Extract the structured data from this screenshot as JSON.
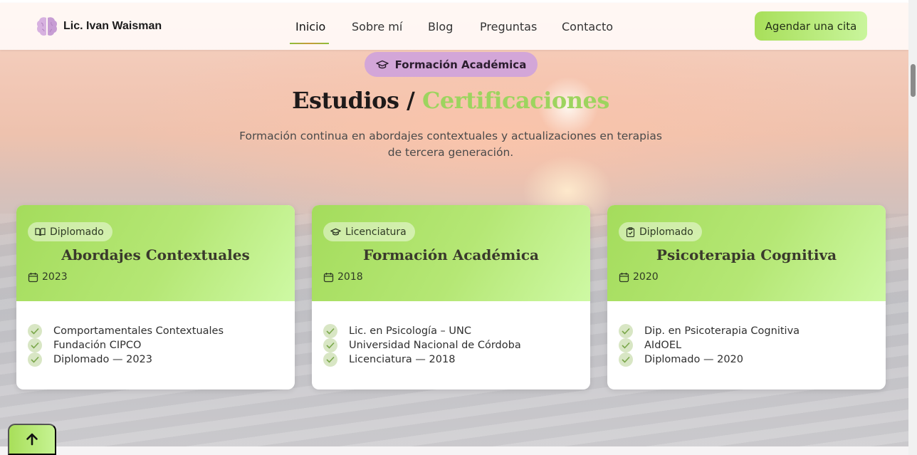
{
  "header": {
    "brand": "Lic. Ivan Waisman",
    "nav": [
      {
        "label": "Inicio",
        "active": true
      },
      {
        "label": "Sobre mí",
        "active": false
      },
      {
        "label": "Blog",
        "active": false
      },
      {
        "label": "Preguntas",
        "active": false
      },
      {
        "label": "Contacto",
        "active": false
      }
    ],
    "cta_label": "Agendar una cita",
    "logo_icon": "brain-icon"
  },
  "section": {
    "badge_label": "Formación Académica",
    "badge_icon": "graduation-cap-icon",
    "title_main": "Estudios",
    "title_sep": " / ",
    "title_accent": "Certificaciones",
    "subtitle": "Formación continua en abordajes contextuales y actualizaciones en terapias de tercera generación."
  },
  "cards": [
    {
      "tag": "Diplomado",
      "tag_icon": "book-open-icon",
      "title": "Abordajes Contextuales",
      "year": "2023",
      "items": [
        "Comportamentales Contextuales",
        "Fundación CIPCO",
        "Diplomado — 2023"
      ]
    },
    {
      "tag": "Licenciatura",
      "tag_icon": "graduation-cap-icon",
      "title": "Formación Académica",
      "year": "2018",
      "items": [
        "Lic. en Psicología – UNC",
        "Universidad Nacional de Córdoba",
        "Licenciatura — 2018"
      ]
    },
    {
      "tag": "Diplomado",
      "tag_icon": "clipboard-check-icon",
      "title": "Psicoterapia Cognitiva",
      "year": "2020",
      "items": [
        "Dip. en Psicoterapia Cognitiva",
        "AIdOEL",
        "Diplomado — 2020"
      ]
    }
  ],
  "colors": {
    "accent_green": "#9dd45f",
    "badge_purple": "#d3a6d8",
    "card_header_start": "#a4dc5c",
    "card_header_end": "#cef9a4"
  }
}
